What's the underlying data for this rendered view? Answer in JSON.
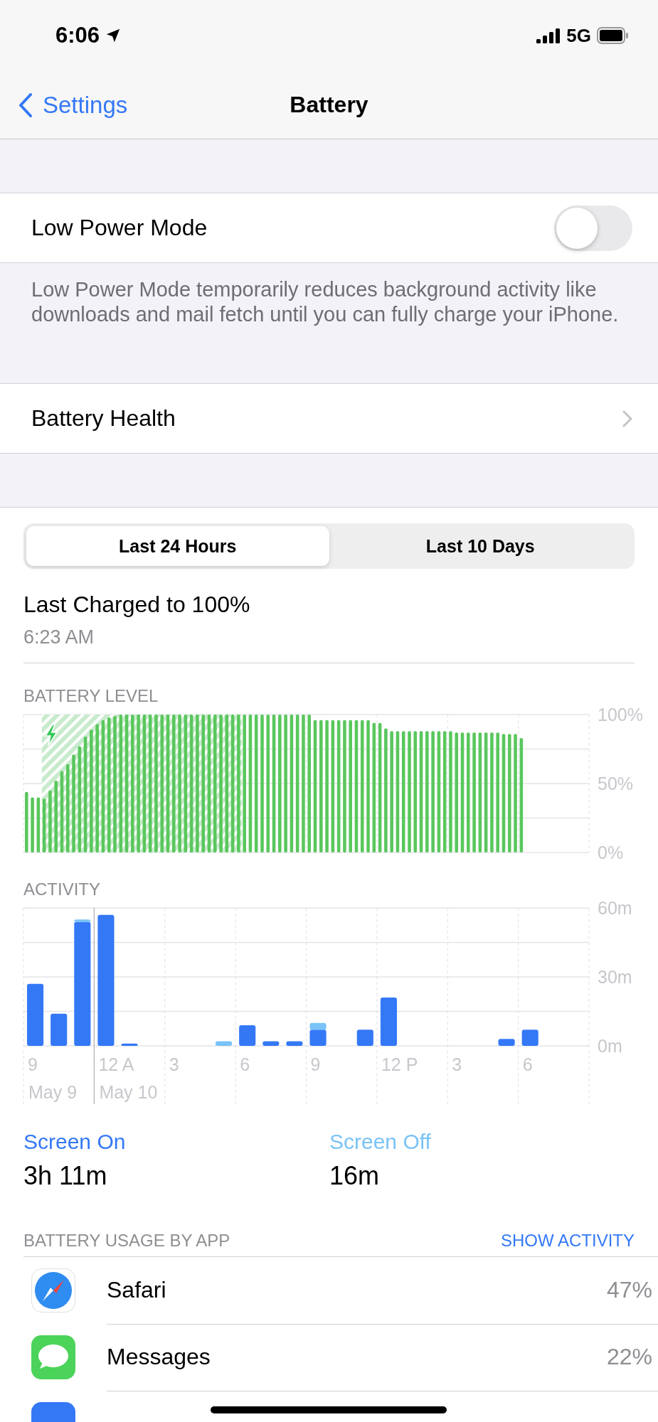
{
  "status_bar": {
    "time": "6:06",
    "network": "5G"
  },
  "nav": {
    "back": "Settings",
    "title": "Battery"
  },
  "low_power": {
    "label": "Low Power Mode",
    "on": false,
    "footer": "Low Power Mode temporarily reduces background activity like downloads and mail fetch until you can fully charge your iPhone."
  },
  "battery_health": {
    "label": "Battery Health"
  },
  "tabs": [
    {
      "label": "Last 24 Hours",
      "selected": true
    },
    {
      "label": "Last 10 Days",
      "selected": false
    }
  ],
  "last_charged": {
    "title": "Last Charged to 100%",
    "time": "6:23 AM"
  },
  "battery_level": {
    "title": "BATTERY LEVEL",
    "chart_data": {
      "type": "bar",
      "ylim": [
        0,
        100
      ],
      "yticks": [
        {
          "value": 0,
          "label": "0%"
        },
        {
          "value": 50,
          "label": "50%"
        },
        {
          "value": 100,
          "label": "100%"
        }
      ],
      "grid": true,
      "values": [
        44,
        40,
        40,
        39,
        45,
        52,
        59,
        64,
        71,
        77,
        84,
        89,
        93,
        96,
        98,
        99,
        100,
        100,
        100,
        100,
        100,
        100,
        100,
        100,
        100,
        100,
        100,
        100,
        100,
        100,
        100,
        100,
        100,
        100,
        100,
        100,
        100,
        100,
        100,
        100,
        100,
        100,
        100,
        100,
        100,
        100,
        100,
        100,
        100,
        96,
        96,
        96,
        96,
        96,
        96,
        96,
        96,
        96,
        96,
        94,
        94,
        90,
        88,
        88,
        88,
        88,
        88,
        88,
        88,
        88,
        88,
        88,
        88,
        87,
        87,
        87,
        87,
        87,
        87,
        87,
        87,
        86,
        86,
        86,
        83,
        null,
        null,
        null,
        null,
        null,
        null,
        null,
        null,
        null,
        null,
        null
      ]
    }
  },
  "activity": {
    "title": "ACTIVITY",
    "chart_data": {
      "type": "bar",
      "stacked": true,
      "ylim": [
        0,
        60
      ],
      "yticks": [
        {
          "value": 0,
          "label": "0m"
        },
        {
          "value": 30,
          "label": "30m"
        },
        {
          "value": 60,
          "label": "60m"
        }
      ],
      "categories": [
        "9",
        null,
        null,
        "12 A",
        null,
        null,
        "3",
        null,
        null,
        "6",
        null,
        null,
        "9",
        null,
        null,
        "12 P",
        null,
        null,
        "3",
        null,
        null,
        "6",
        null,
        null
      ],
      "series": [
        {
          "name": "Screen On",
          "color": "#3478f6",
          "values": [
            27,
            14,
            54,
            57,
            1,
            0,
            0,
            0,
            0,
            9,
            2,
            2,
            7,
            0,
            7,
            21,
            0,
            0,
            0,
            0,
            3,
            7,
            null,
            null
          ]
        },
        {
          "name": "Screen Off",
          "color": "#79c3f7",
          "values": [
            0,
            0,
            1,
            0,
            0,
            0,
            0,
            0,
            2,
            0,
            0,
            0,
            3,
            0,
            0,
            0,
            0,
            0,
            0,
            0,
            0,
            0,
            null,
            null
          ]
        }
      ],
      "grid": true
    },
    "dates": [
      "May 9",
      "May 10"
    ]
  },
  "totals": [
    {
      "value": "3h 11m"
    },
    {
      "value": "16m"
    }
  ],
  "usage": {
    "title": "BATTERY USAGE BY APP",
    "action": "SHOW ACTIVITY",
    "apps": [
      {
        "kind": "compass",
        "name": "Safari",
        "percent": "47%"
      },
      {
        "kind": "bubble",
        "name": "Messages",
        "percent": "22%"
      },
      {
        "kind": "partial"
      }
    ]
  }
}
